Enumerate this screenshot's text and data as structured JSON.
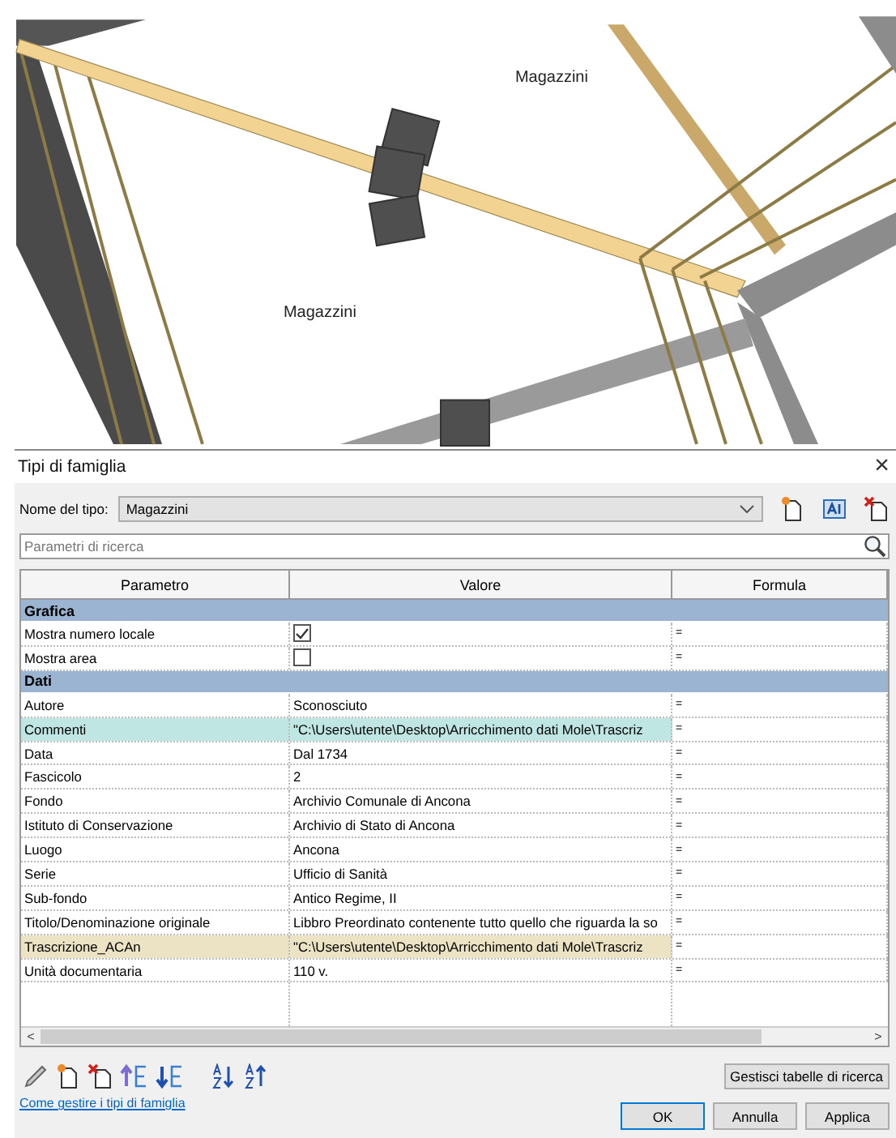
{
  "view": {
    "room_labels": [
      "Magazzini",
      "Magazzini"
    ]
  },
  "dialog": {
    "title": "Tipi di famiglia",
    "close": "×",
    "type_label": "Nome del tipo:",
    "type_value": "Magazzini",
    "search": {
      "placeholder": "Parametri di ricerca"
    },
    "columns": [
      "Parametro",
      "Valore",
      "Formula"
    ],
    "groups": [
      {
        "name": "Grafica",
        "rows": [
          {
            "kind": "checkbox",
            "name": "Mostra numero locale",
            "checked": true,
            "formula": "="
          },
          {
            "kind": "checkbox",
            "name": "Mostra area",
            "checked": false,
            "formula": "="
          }
        ]
      },
      {
        "name": "Dati",
        "rows": [
          {
            "kind": "text",
            "name": "Autore",
            "value": "Sconosciuto",
            "formula": "="
          },
          {
            "kind": "text",
            "name": "Commenti",
            "value": "\"C:\\Users\\utente\\Desktop\\Arricchimento dati Mole\\Trascriz",
            "formula": "=",
            "color": "#bfe6e3"
          },
          {
            "kind": "text",
            "name": "Data",
            "value": "Dal 1734",
            "formula": "="
          },
          {
            "kind": "text",
            "name": "Fascicolo",
            "value": "2",
            "formula": "="
          },
          {
            "kind": "text",
            "name": "Fondo",
            "value": "Archivio Comunale di Ancona",
            "formula": "="
          },
          {
            "kind": "text",
            "name": "Istituto di Conservazione",
            "value": "Archivio di Stato di Ancona",
            "formula": "="
          },
          {
            "kind": "text",
            "name": "Luogo",
            "value": "Ancona",
            "formula": "="
          },
          {
            "kind": "text",
            "name": "Serie",
            "value": "Ufficio di Sanità",
            "formula": "="
          },
          {
            "kind": "text",
            "name": "Sub-fondo",
            "value": "Antico Regime, II",
            "formula": "="
          },
          {
            "kind": "text",
            "name": "Titolo/Denominazione originale",
            "value": "Libbro Preordinato contenente tutto quello che riguarda la so",
            "formula": "="
          },
          {
            "kind": "text",
            "name": "Trascrizione_ACAn",
            "value": "\"C:\\Users\\utente\\Desktop\\Arricchimento dati Mole\\Trascriz",
            "formula": "=",
            "color": "#ebe3c3"
          },
          {
            "kind": "text",
            "name": "Unità documentaria",
            "value": "110 v.",
            "formula": "="
          }
        ]
      }
    ],
    "scroll_left": "<",
    "scroll_right": ">",
    "lookup_button": "Gestisci tabelle di ricerca",
    "help_link": "Come gestire i tipi di famiglia",
    "buttons": [
      {
        "label": "OK",
        "default": true
      },
      {
        "label": "Annulla",
        "default": false
      },
      {
        "label": "Applica",
        "default": false
      }
    ]
  }
}
